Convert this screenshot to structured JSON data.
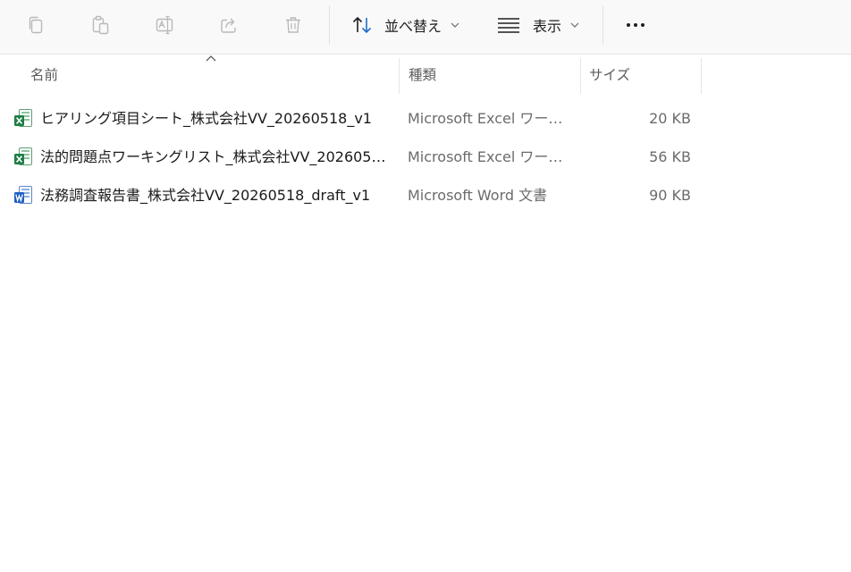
{
  "toolbar": {
    "icons": [
      {
        "name": "copy-icon",
        "enabled": false
      },
      {
        "name": "paste-icon",
        "enabled": false
      },
      {
        "name": "rename-icon",
        "enabled": false
      },
      {
        "name": "share-icon",
        "enabled": false
      },
      {
        "name": "delete-icon",
        "enabled": false
      }
    ],
    "sort_label": "並べ替え",
    "view_label": "表示",
    "more_icon": "more-icon"
  },
  "columns": {
    "name": "名前",
    "type": "種類",
    "size": "サイズ",
    "sorted_by": "name",
    "sort_direction": "ascending"
  },
  "files": [
    {
      "name": "ヒアリング項目シート_株式会社VV_20260518_v1",
      "type": "Microsoft Excel ワーク...",
      "size": "20 KB",
      "icon": "excel-file-icon"
    },
    {
      "name": "法的問題点ワーキングリスト_株式会社VV_2026051...",
      "type": "Microsoft Excel ワーク...",
      "size": "56 KB",
      "icon": "excel-file-icon"
    },
    {
      "name": "法務調査報告書_株式会社VV_20260518_draft_v1",
      "type": "Microsoft Word 文書",
      "size": "90 KB",
      "icon": "word-file-icon"
    }
  ],
  "colors": {
    "icon_disabled": "#b9b9b9",
    "excel_green": "#1e7e45",
    "word_blue": "#1f5fc4",
    "toolbar_bg": "#f9f9f9"
  }
}
